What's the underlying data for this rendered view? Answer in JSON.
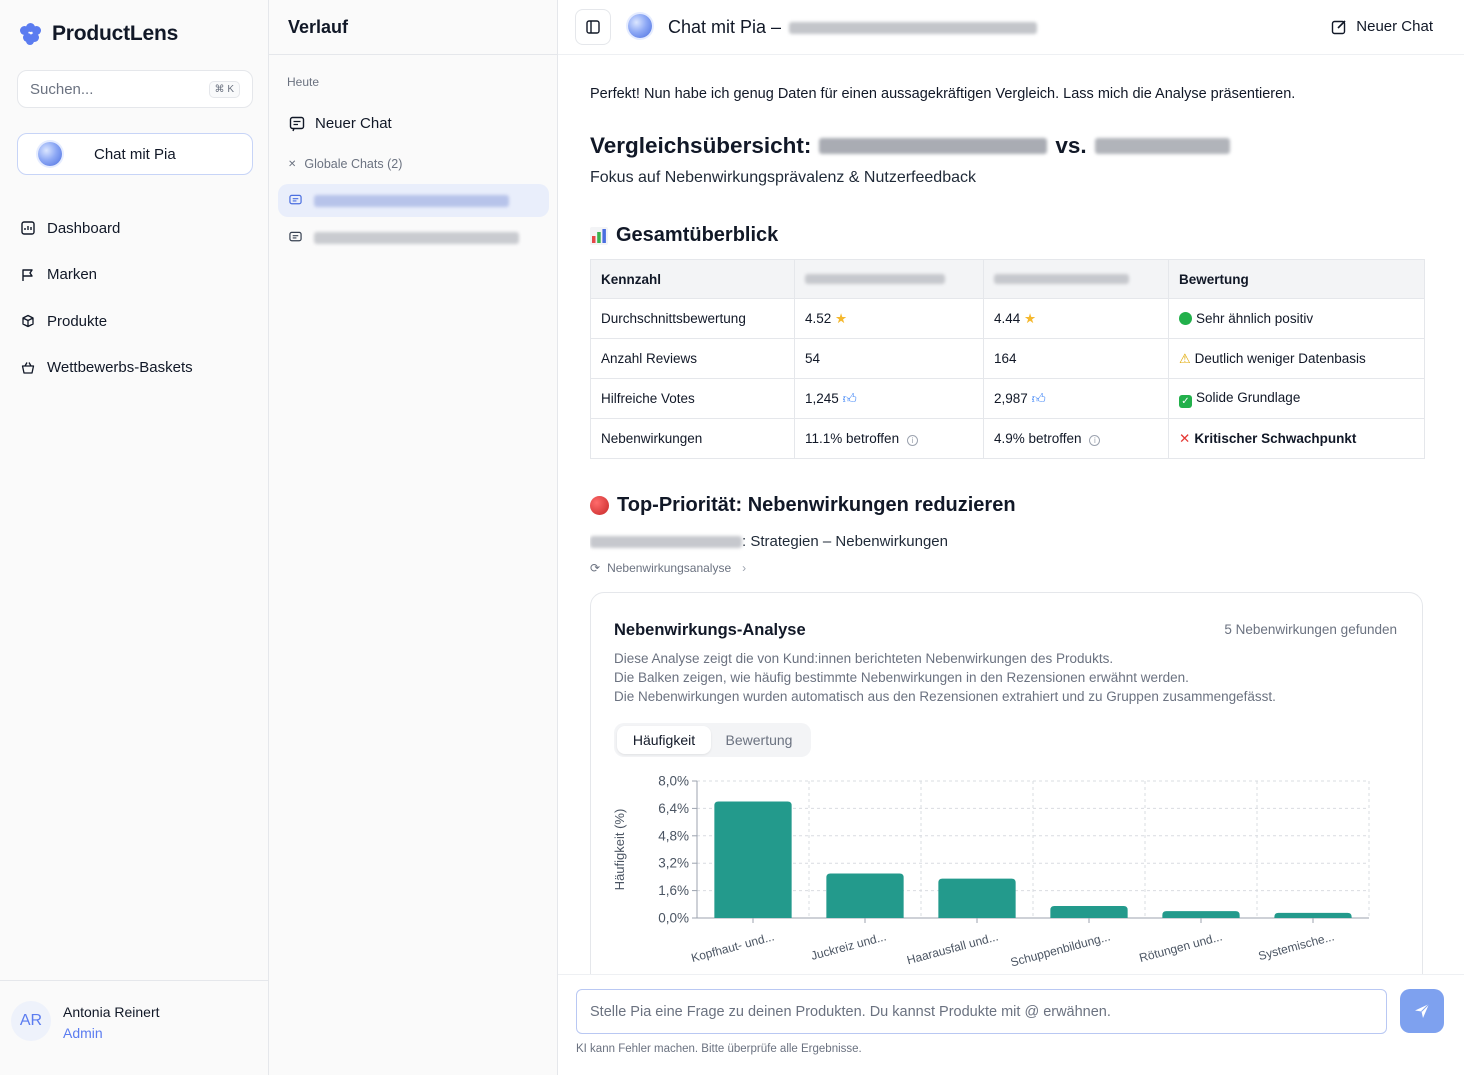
{
  "app": {
    "name": "ProductLens",
    "search_placeholder": "Suchen...",
    "search_shortcut": "⌘ K",
    "chat_button": "Chat mit Pia",
    "nav": [
      {
        "label": "Dashboard",
        "icon": "dashboard-icon"
      },
      {
        "label": "Marken",
        "icon": "flag-icon"
      },
      {
        "label": "Produkte",
        "icon": "box-icon"
      },
      {
        "label": "Wettbewerbs-Baskets",
        "icon": "basket-icon"
      }
    ],
    "user": {
      "initials": "AR",
      "name": "Antonia Reinert",
      "role": "Admin"
    }
  },
  "history": {
    "title": "Verlauf",
    "group_today": "Heute",
    "new_chat": "Neuer Chat",
    "global_chats": "Globale Chats (2)"
  },
  "topbar": {
    "title": "Chat mit Pia –",
    "new_chat": "Neuer Chat"
  },
  "message": {
    "intro": "Perfekt! Nun habe ich genug Daten für einen aussagekräftigen Vergleich. Lass mich die Analyse präsentieren.",
    "heading_prefix": "Vergleichsübersicht:",
    "heading_vs": "vs.",
    "subheading": "Fokus auf Nebenwirkungsprävalenz & Nutzerfeedback",
    "overview_heading": "Gesamtüberblick",
    "table": {
      "headers": [
        "Kennzahl",
        "",
        "",
        "Bewertung"
      ],
      "rows": [
        {
          "metric": "Durchschnittsbewertung",
          "a": "4.52",
          "a_icon": "star-icon",
          "b": "4.44",
          "b_icon": "star-icon",
          "status_icon": "green-circle-icon",
          "rating": "Sehr ähnlich positiv"
        },
        {
          "metric": "Anzahl Reviews",
          "a": "54",
          "a_icon": "",
          "b": "164",
          "b_icon": "",
          "status_icon": "warning-icon",
          "rating": "Deutlich weniger Datenbasis"
        },
        {
          "metric": "Hilfreiche Votes",
          "a": "1,245",
          "a_icon": "thumbs-up-icon",
          "b": "2,987",
          "b_icon": "thumbs-up-icon",
          "status_icon": "check-box-icon",
          "rating": "Solide Grundlage"
        },
        {
          "metric": "Nebenwirkungen",
          "a": "11.1% betroffen",
          "a_icon": "info-icon",
          "b": "4.9% betroffen",
          "b_icon": "info-icon",
          "status_icon": "cross-icon",
          "rating": "Kritischer Schwachpunkt"
        }
      ]
    },
    "priority_heading": "Top-Priorität: Nebenwirkungen reduzieren",
    "priority_sub": ": Strategien – Nebenwirkungen",
    "tool_chip": "Nebenwirkungsanalyse"
  },
  "card": {
    "title": "Nebenwirkungs-Analyse",
    "count": "5 Nebenwirkungen gefunden",
    "desc": [
      "Diese Analyse zeigt die von Kund:innen berichteten Nebenwirkungen des Produkts.",
      "Die Balken zeigen, wie häufig bestimmte Nebenwirkungen in den Rezensionen erwähnt werden.",
      "Die Nebenwirkungen wurden automatisch aus den Rezensionen extrahiert und zu Gruppen zusammengefässt."
    ],
    "tabs": [
      "Häufigkeit",
      "Bewertung"
    ],
    "active_tab": "Häufigkeit"
  },
  "chart_data": {
    "type": "bar",
    "categories": [
      "Kopfhaut- und...",
      "Juckreiz und...",
      "Haarausfall und...",
      "Schuppenbildung...",
      "Rötungen und...",
      "Systemische..."
    ],
    "values": [
      6.8,
      2.6,
      2.3,
      0.7,
      0.4,
      0.3
    ],
    "ylabel": "Häufigkeit (%)",
    "ylim": [
      0,
      8
    ],
    "yticks": [
      "0,0%",
      "1,6%",
      "3,2%",
      "4,8%",
      "6,4%",
      "8,0%"
    ],
    "ytick_values": [
      0,
      1.6,
      3.2,
      4.8,
      6.4,
      8.0
    ],
    "grid": true,
    "bar_color": "#239a8c"
  },
  "composer": {
    "placeholder": "Stelle Pia eine Frage zu deinen Produkten. Du kannst Produkte mit @ erwähnen.",
    "disclaimer": "KI kann Fehler machen. Bitte überprüfe alle Ergebnisse."
  },
  "colors": {
    "accent": "#5b7cf0",
    "send": "#7ea1ef",
    "bar": "#239a8c"
  }
}
